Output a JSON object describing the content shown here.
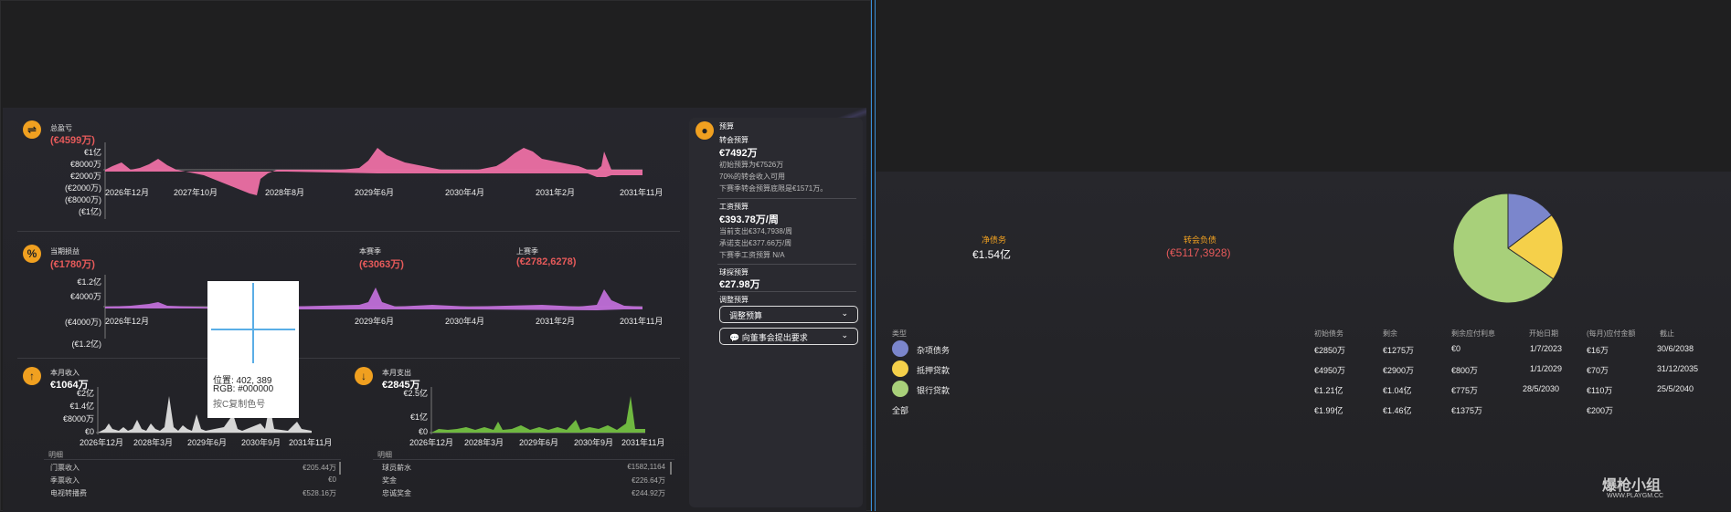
{
  "left": {
    "balance": {
      "title": "总盈亏",
      "value": "(€4599万)",
      "y_ticks": [
        "€1亿",
        "€8000万",
        "€2000万",
        "(€2000万)",
        "(€8000万)",
        "(€1亿)"
      ],
      "x_ticks": [
        "2026年12月",
        "2027年10月",
        "2028年8月",
        "2029年6月",
        "2030年4月",
        "2031年2月",
        "2031年11月"
      ]
    },
    "profit": {
      "title": "当期损益",
      "value": "(€1780万)",
      "this_season_title": "本赛季",
      "this_season_value": "(€3063万)",
      "last_season_title": "上赛季",
      "last_season_value": "(€2782,6278)",
      "y_ticks": [
        "€1.2亿",
        "€4000万",
        "(€4000万)",
        "(€1.2亿)"
      ],
      "x_ticks": [
        "2026年12月",
        "2029年6月",
        "2030年4月",
        "2031年2月",
        "2031年11月"
      ]
    },
    "income": {
      "title": "本月收入",
      "value": "€1064万",
      "y_ticks": [
        "€2亿",
        "€1.4亿",
        "€8000万",
        "€0"
      ],
      "x_ticks": [
        "2026年12月",
        "2028年3月",
        "2029年6月",
        "2030年9月",
        "2031年11月"
      ],
      "detail_label": "明细",
      "rows": [
        {
          "label": "门票收入",
          "value": "€205.44万"
        },
        {
          "label": "季票收入",
          "value": "€0"
        },
        {
          "label": "电视转播费",
          "value": "€528.16万"
        }
      ]
    },
    "expense": {
      "title": "本月支出",
      "value": "€2845万",
      "y_ticks": [
        "€2.5亿",
        "€1亿",
        "€0"
      ],
      "x_ticks": [
        "2026年12月",
        "2028年3月",
        "2029年6月",
        "2030年9月",
        "2031年11月"
      ],
      "detail_label": "明细",
      "rows": [
        {
          "label": "球员薪水",
          "value": "€1582,1164"
        },
        {
          "label": "奖金",
          "value": "€226.64万"
        },
        {
          "label": "忠诚奖金",
          "value": "€244.92万"
        }
      ]
    },
    "tooltip": {
      "pos": "位置: 402, 389",
      "rgb": "RGB: #000000",
      "hint": "按C复制色号"
    },
    "budget": {
      "title": "预算",
      "transfer_label": "转会预算",
      "transfer_value": "€7492万",
      "transfer_lines": [
        "初始预算为€7526万",
        "70%的转会收入可用",
        "下赛季转会预算底限是€1571万。"
      ],
      "wage_label": "工资预算",
      "wage_value": "€393.78万/周",
      "wage_lines": [
        "当前支出€374,7938/周",
        "承诺支出€377.66万/周",
        "下赛季工资预算 N/A"
      ],
      "scout_label": "球探预算",
      "scout_value": "€27.98万",
      "adjust_label": "调整预算",
      "adjust_button": "调整预算",
      "request_button": "向董事会提出要求"
    }
  },
  "right": {
    "net_debt_label": "净债务",
    "net_debt_value": "€1.54亿",
    "transfer_debt_label": "转会负债",
    "transfer_debt_value": "(€5117,3928)",
    "table": {
      "headers": [
        "类型",
        "初始债务",
        "剩余",
        "剩余应付利息",
        "开始日期",
        "(每月)应付金额",
        "截止"
      ],
      "rows": [
        {
          "name": "杂项债务",
          "color": "#7b86cc",
          "cells": [
            "€2850万",
            "€1275万",
            "€0",
            "1/7/2023",
            "€16万",
            "30/6/2038"
          ]
        },
        {
          "name": "抵押贷款",
          "color": "#f5d04a",
          "cells": [
            "€4950万",
            "€2900万",
            "€800万",
            "1/1/2029",
            "€70万",
            "31/12/2035"
          ]
        },
        {
          "name": "银行贷款",
          "color": "#a8d07a",
          "cells": [
            "€1.21亿",
            "€1.04亿",
            "€775万",
            "28/5/2030",
            "€110万",
            "25/5/2040"
          ]
        }
      ],
      "total": {
        "name": "全部",
        "cells": [
          "€1.99亿",
          "€1.46亿",
          "€1375万",
          "",
          "€200万",
          ""
        ]
      }
    },
    "pie_colors": [
      "#7b86cc",
      "#f5d04a",
      "#a8d07a"
    ],
    "pie_values": [
      0.1465,
      0.1986,
      0.6549
    ],
    "watermark": "爆枪小组",
    "watermark_sub": "WWW.PLAYGM.CC"
  }
}
